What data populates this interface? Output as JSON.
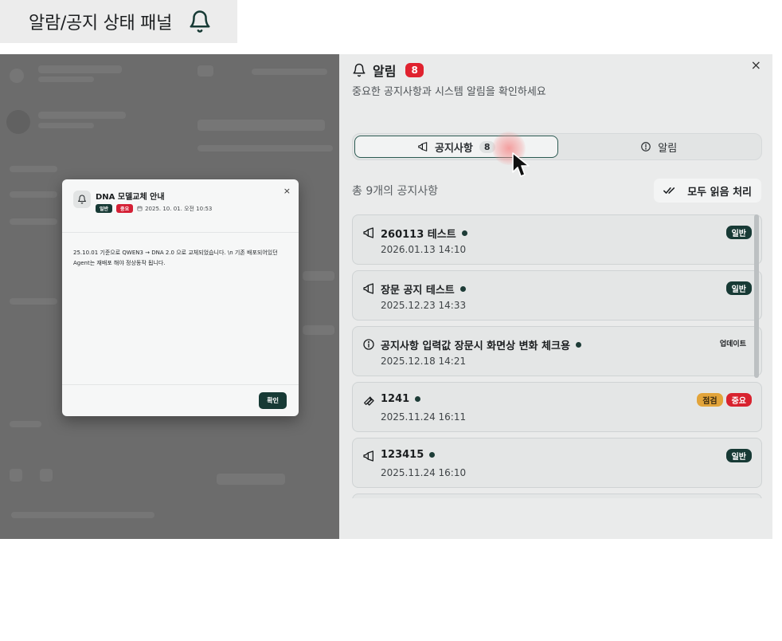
{
  "caption": {
    "text": "알람/공지 상태 패널"
  },
  "modal": {
    "title": "DNA 모델교체 안내",
    "close": "×",
    "tags": [
      "일반",
      "중요"
    ],
    "date": "2025. 10. 01. 오전 10:53",
    "body": "25.10.01 기준으로 QWEN3 → DNA 2.0 으로 교체되었습니다. \\n 기존 배포되어있던 Agent는 재배포 해야 정상동작 됩니다.",
    "ok_label": "확인"
  },
  "panel": {
    "title": "알림",
    "count": "8",
    "close": "×",
    "subtitle": "중요한 공지사항과 시스템 알림을 확인하세요",
    "tabs": [
      {
        "label": "공지사항",
        "count": "8",
        "active": true
      },
      {
        "label": "알림",
        "active": false
      }
    ],
    "total_text": "총 9개의 공지사항",
    "mark_all_label": "모두 읽음 처리",
    "items": [
      {
        "title": "260113 테스트",
        "date": "2026.01.13 14:10",
        "icon": "megaphone-icon",
        "tags": [
          {
            "label": "일반",
            "kind": "general"
          }
        ]
      },
      {
        "title": "장문 공지 테스트",
        "date": "2025.12.23 14:33",
        "icon": "megaphone-icon",
        "tags": [
          {
            "label": "일반",
            "kind": "general"
          }
        ]
      },
      {
        "title": "공지사항 입력값 장문시 화면상 변화 체크용",
        "date": "2025.12.18 14:21",
        "icon": "info-icon",
        "tags": [
          {
            "label": "업데이트",
            "kind": "update"
          }
        ]
      },
      {
        "title": "1241",
        "date": "2025.11.24 16:11",
        "icon": "wrench-icon",
        "tags": [
          {
            "label": "점검",
            "kind": "maint"
          },
          {
            "label": "중요",
            "kind": "important"
          }
        ]
      },
      {
        "title": "123415",
        "date": "2025.11.24 16:10",
        "icon": "megaphone-icon",
        "tags": [
          {
            "label": "일반",
            "kind": "general"
          }
        ]
      }
    ]
  },
  "colors": {
    "accent": "#173a35",
    "danger": "#e0222f",
    "warning": "#e2a43a"
  }
}
